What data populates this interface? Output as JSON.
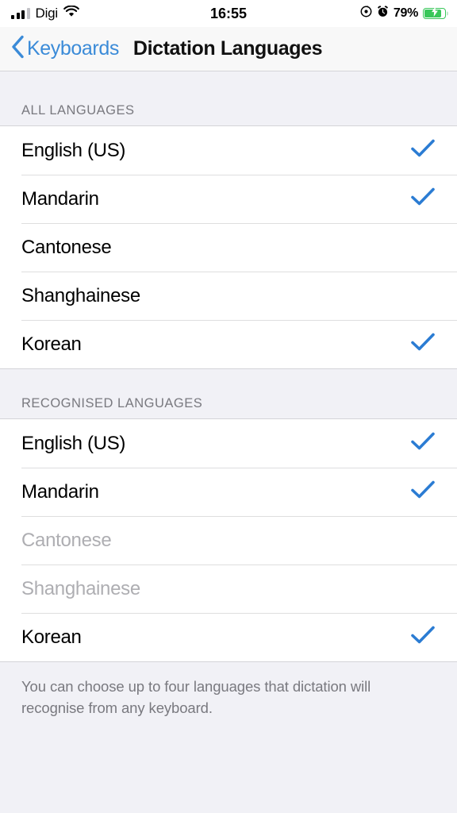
{
  "status_bar": {
    "carrier": "Digi",
    "time": "16:55",
    "battery_percent": "79%",
    "signal_icon": "cellular-signal-icon",
    "wifi_icon": "wifi-icon",
    "rotation_lock_icon": "rotation-lock-icon",
    "alarm_icon": "alarm-clock-icon",
    "battery_icon": "battery-charging-icon"
  },
  "nav": {
    "back_label": "Keyboards",
    "title": "Dictation Languages",
    "back_icon": "chevron-left-icon"
  },
  "colors": {
    "accent_blue": "#007aff",
    "back_blue": "#3b8bd8",
    "checkmark_blue": "#2b7cd3",
    "battery_green": "#39c75a",
    "disabled_gray": "#aeaeb2",
    "header_gray": "#79797f",
    "page_background": "#f1f1f6",
    "row_background": "#ffffff"
  },
  "sections": [
    {
      "header": "ALL LANGUAGES",
      "rows": [
        {
          "label": "English (US)",
          "checked": true,
          "disabled": false,
          "check_icon": "checkmark-icon"
        },
        {
          "label": "Mandarin",
          "checked": true,
          "disabled": false,
          "check_icon": "checkmark-icon"
        },
        {
          "label": "Cantonese",
          "checked": false,
          "disabled": false,
          "check_icon": "checkmark-icon"
        },
        {
          "label": "Shanghainese",
          "checked": false,
          "disabled": false,
          "check_icon": "checkmark-icon"
        },
        {
          "label": "Korean",
          "checked": true,
          "disabled": false,
          "check_icon": "checkmark-icon"
        }
      ]
    },
    {
      "header": "RECOGNISED LANGUAGES",
      "rows": [
        {
          "label": "English (US)",
          "checked": true,
          "disabled": false,
          "check_icon": "checkmark-icon"
        },
        {
          "label": "Mandarin",
          "checked": true,
          "disabled": false,
          "check_icon": "checkmark-icon"
        },
        {
          "label": "Cantonese",
          "checked": false,
          "disabled": true,
          "check_icon": "checkmark-icon"
        },
        {
          "label": "Shanghainese",
          "checked": false,
          "disabled": true,
          "check_icon": "checkmark-icon"
        },
        {
          "label": "Korean",
          "checked": true,
          "disabled": false,
          "check_icon": "checkmark-icon"
        }
      ],
      "footer": "You can choose up to four languages that dictation will recognise from any keyboard."
    }
  ]
}
